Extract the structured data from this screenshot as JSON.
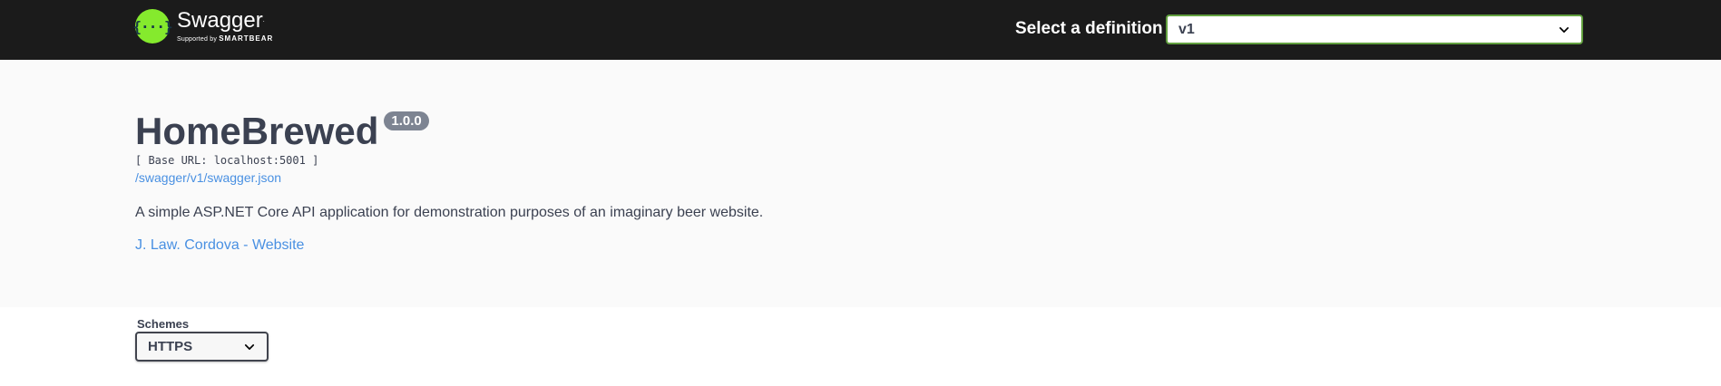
{
  "topbar": {
    "logo": {
      "name": "Swagger",
      "supported_by": "Supported by",
      "company": "SMARTBEAR"
    },
    "definition_label": "Select a definition",
    "definition_selected": "v1"
  },
  "info": {
    "title": "HomeBrewed",
    "version": "1.0.0",
    "base_url": "[ Base URL: localhost:5001 ]",
    "spec_link": "/swagger/v1/swagger.json",
    "description": "A simple ASP.NET Core API application for demonstration purposes of an imaginary beer website.",
    "contact_link": "J. Law. Cordova - Website"
  },
  "schemes": {
    "label": "Schemes",
    "selected": "HTTPS"
  },
  "colors": {
    "topbar_bg": "#1b1b1b",
    "logo_green": "#85ea2d",
    "select_border": "#62a03f",
    "link": "#4990e2",
    "version_badge": "#7d8492"
  },
  "icons": [
    "swagger-logo-icon",
    "chevron-down-icon"
  ]
}
